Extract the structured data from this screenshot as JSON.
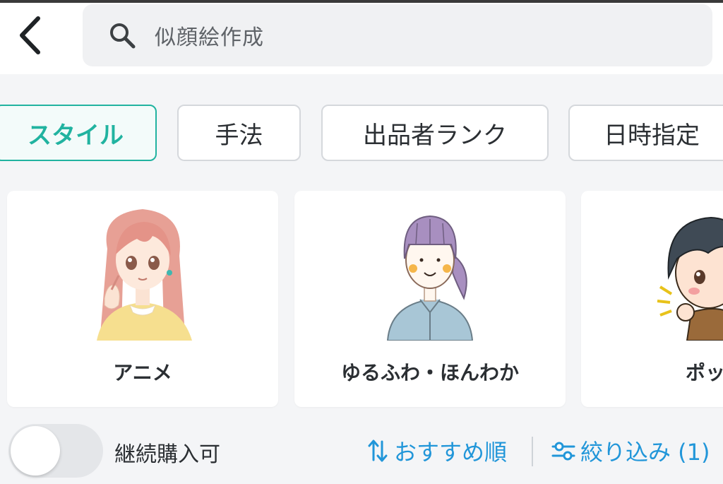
{
  "header": {
    "back_icon": "chevron-left-icon",
    "search_icon": "search-icon",
    "search_text": "似顔絵作成"
  },
  "filters": {
    "chips": [
      {
        "label": "スタイル",
        "active": true
      },
      {
        "label": "手法",
        "active": false
      },
      {
        "label": "出品者ランク",
        "active": false
      },
      {
        "label": "日時指定",
        "active": false
      }
    ]
  },
  "styles": {
    "cards": [
      {
        "label": "アニメ",
        "image": "anime-girl-illustration"
      },
      {
        "label": "ゆるふわ・ほんわか",
        "image": "soft-style-girl-illustration"
      },
      {
        "label": "ポッ",
        "image": "pop-style-boy-illustration"
      }
    ]
  },
  "bottom": {
    "toggle_label": "継続購入可",
    "toggle_on": false,
    "sort_label": "おすすめ順",
    "sort_icon": "sort-arrows-icon",
    "filter_label": "絞り込み (1)",
    "filter_icon": "sliders-icon"
  },
  "colors": {
    "accent": "#21b3a0",
    "link": "#2196d9",
    "text": "#2b2f33"
  }
}
